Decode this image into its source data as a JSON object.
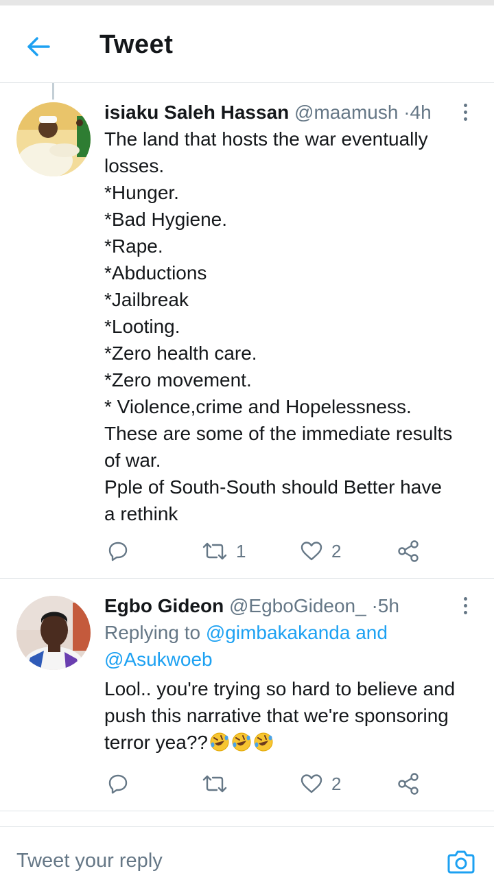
{
  "header": {
    "title": "Tweet",
    "back_icon": "arrow-left-icon"
  },
  "tweets": [
    {
      "name": "isiaku Saleh Hassan",
      "handle": "@maamush",
      "separator": "·",
      "time": "4h",
      "text_lines": [
        "The land that hosts the war eventually",
        "losses.",
        "*Hunger.",
        "*Bad Hygiene.",
        "*Rape.",
        "*Abductions",
        "*Jailbreak",
        "*Looting.",
        "*Zero health care.",
        "*Zero movement.",
        "* Violence,crime and Hopelessness.",
        "These are some of the immediate results",
        "of war.",
        "Pple of South-South should Better have",
        "a rethink"
      ],
      "retweets": "1",
      "likes": "2"
    },
    {
      "name": "Egbo Gideon",
      "handle": "@EgboGideon_",
      "separator": "·",
      "time": "5h",
      "replying_prefix": "Replying to",
      "replying_mention1": "@gimbakakanda",
      "replying_and": "and",
      "replying_mention2": "@Asukwoeb",
      "text_lines": [
        "Lool.. you're trying so hard to believe and",
        "push this narrative that we're sponsoring",
        "terror yea??"
      ],
      "emoji": "rolling-on-floor-laughing-emoji",
      "retweets": "",
      "likes": "2"
    }
  ],
  "composer": {
    "placeholder": "Tweet your reply",
    "camera_icon": "camera-icon"
  },
  "colors": {
    "accent": "#1da1f2",
    "text": "#14171a",
    "secondary": "#657786",
    "divider": "#dfe3e6"
  }
}
